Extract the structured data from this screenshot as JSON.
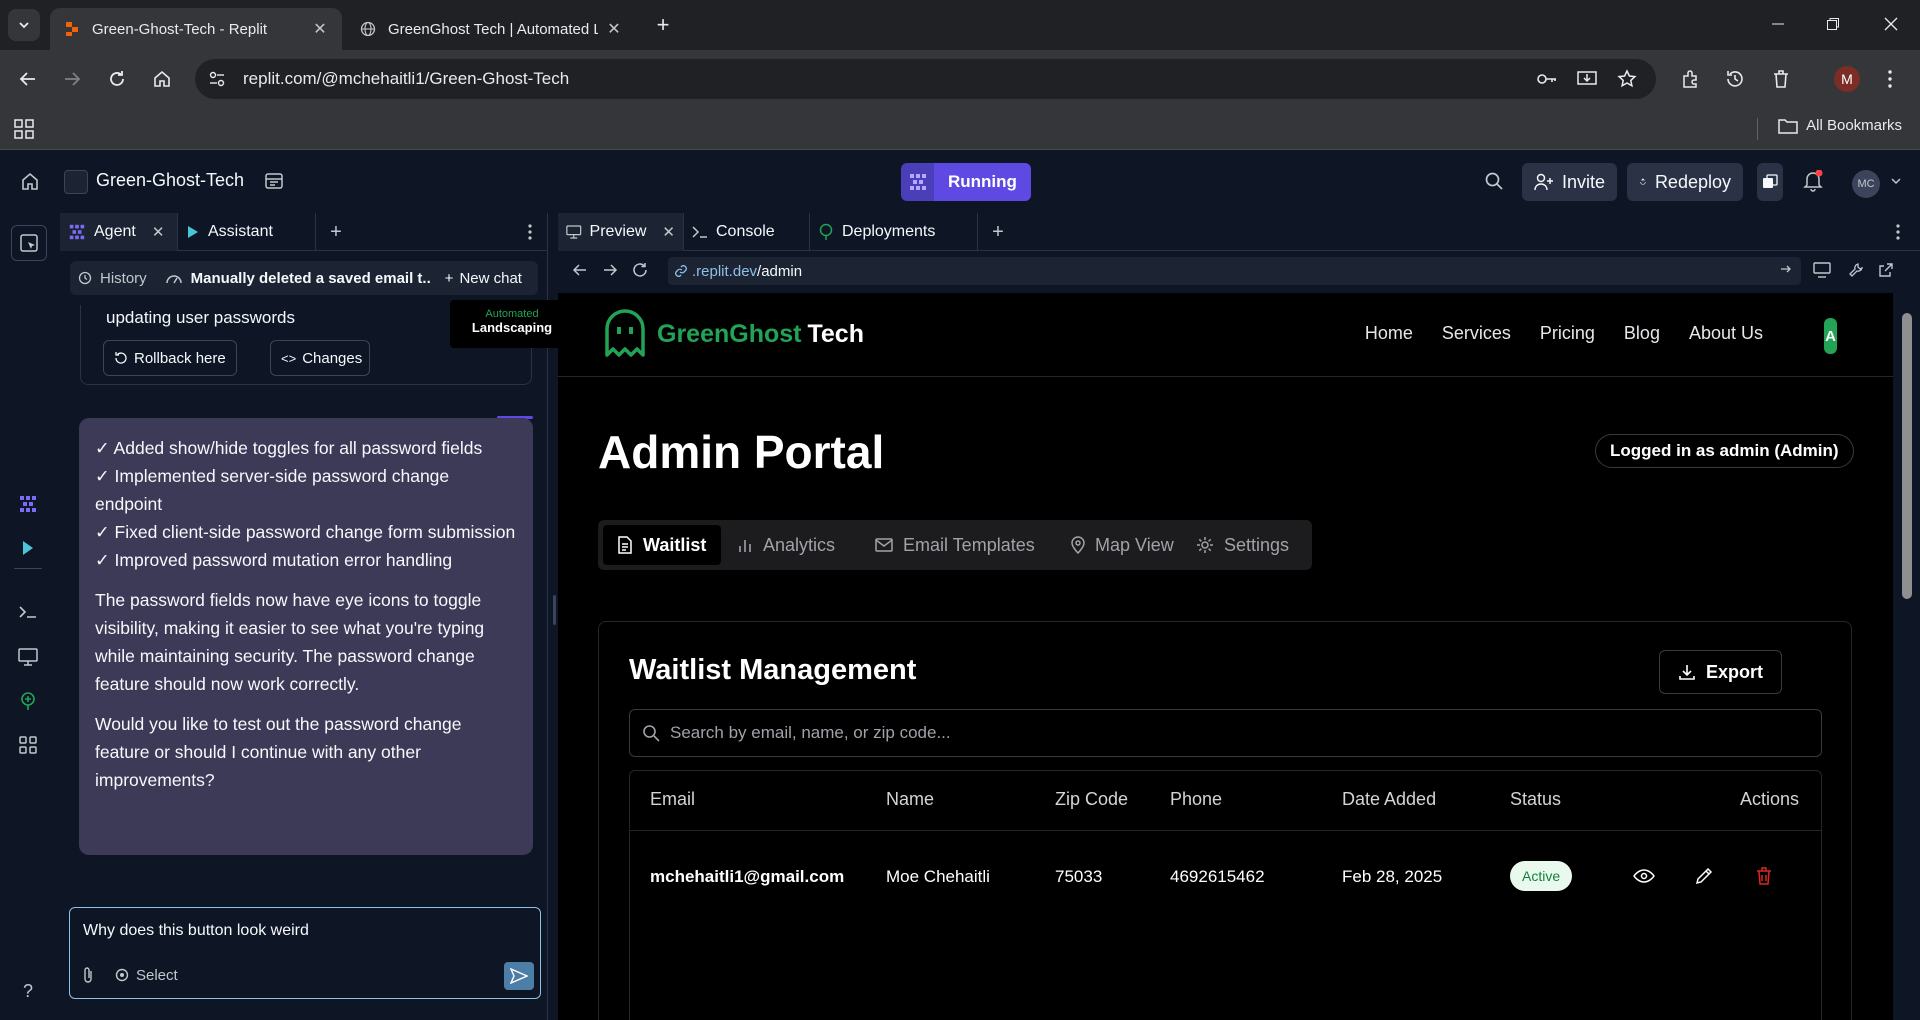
{
  "browser": {
    "tabs": [
      {
        "title": "Green-Ghost-Tech - Replit",
        "active": true
      },
      {
        "title": "GreenGhost Tech | Automated L",
        "active": false
      }
    ],
    "url": "replit.com/@mchehaitli1/Green-Ghost-Tech",
    "bookmarks_label": "All Bookmarks",
    "profile_initial": "M"
  },
  "replit": {
    "project_name": "Green-Ghost-Tech",
    "run_label": "Running",
    "invite_label": "Invite",
    "redeploy_label": "Redeploy",
    "user_initials": "MC",
    "left_tabs": [
      {
        "label": "Agent"
      },
      {
        "label": "Assistant"
      }
    ],
    "history_label": "History",
    "chat_title": "Manually deleted a saved email t...",
    "new_chat_label": "New chat",
    "checkpoint_text": "updating user passwords",
    "thumb_line1": "Automated",
    "thumb_line2": "Landscaping",
    "rollback_label": "Rollback here",
    "changes_label": "Changes",
    "message_lines": [
      "✓ Added show/hide toggles for all password fields",
      "✓ Implemented server-side password change endpoint",
      "✓ Fixed client-side password change form submission",
      "✓ Improved password mutation error handling"
    ],
    "message_para1": "The password fields now have eye icons to toggle visibility, making it easier to see what you're typing while maintaining security. The password change feature should now work correctly.",
    "message_para2": "Would you like to test out the password change feature or should I continue with any other improvements?",
    "composer_text": "Why does this button look weird",
    "select_label": "Select",
    "right_tabs": [
      {
        "label": "Preview"
      },
      {
        "label": "Console"
      },
      {
        "label": "Deployments"
      }
    ],
    "preview_url_domain": ".replit.dev",
    "preview_url_path": "/admin"
  },
  "site": {
    "brand_green": "GreenGhost",
    "brand_white": "Tech",
    "nav": [
      "Home",
      "Services",
      "Pricing",
      "Blog",
      "About Us"
    ],
    "nav_avatar": "A",
    "page_title": "Admin Portal",
    "logged_in": "Logged in as admin (Admin)",
    "tabs": [
      "Waitlist",
      "Analytics",
      "Email Templates",
      "Map View",
      "Settings"
    ],
    "card_title": "Waitlist Management",
    "export_label": "Export",
    "search_placeholder": "Search by email, name, or zip code...",
    "columns": [
      "Email",
      "Name",
      "Zip Code",
      "Phone",
      "Date Added",
      "Status",
      "Actions"
    ],
    "rows": [
      {
        "email": "mchehaitli1@gmail.com",
        "name": "Moe Chehaitli",
        "zip": "75033",
        "phone": "4692615462",
        "date": "Feb 28, 2025",
        "status": "Active"
      }
    ]
  },
  "colors": {
    "brand_green": "#22a355",
    "run_purple": "#5e4ae3",
    "message_bg": "#3c3a57",
    "delete_red": "#dc2626"
  }
}
